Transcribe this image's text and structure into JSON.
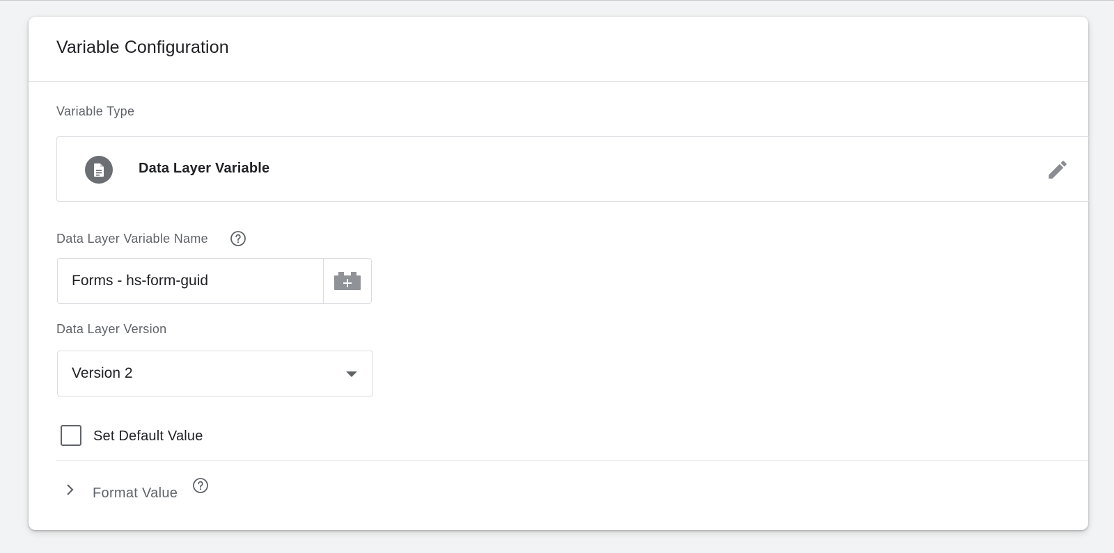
{
  "card": {
    "title": "Variable Configuration"
  },
  "variable_type": {
    "label": "Variable Type",
    "name": "Data Layer Variable",
    "icon": "document-icon",
    "edit_icon": "pencil-icon"
  },
  "variable_name": {
    "label": "Data Layer Variable Name",
    "value": "Forms - hs-form-guid",
    "help_icon": "help-circle-icon",
    "picker_icon": "variable-brick-plus-icon"
  },
  "version": {
    "label": "Data Layer Version",
    "selected": "Version 2"
  },
  "default_value": {
    "label": "Set Default Value",
    "checked": false
  },
  "format_value": {
    "label": "Format Value",
    "expanded": false
  },
  "colors": {
    "background": "#f1f3f4",
    "card": "#ffffff",
    "border": "#dadce0",
    "text_primary": "#202124",
    "text_secondary": "#5f6368",
    "icon": "#6b6e72"
  }
}
